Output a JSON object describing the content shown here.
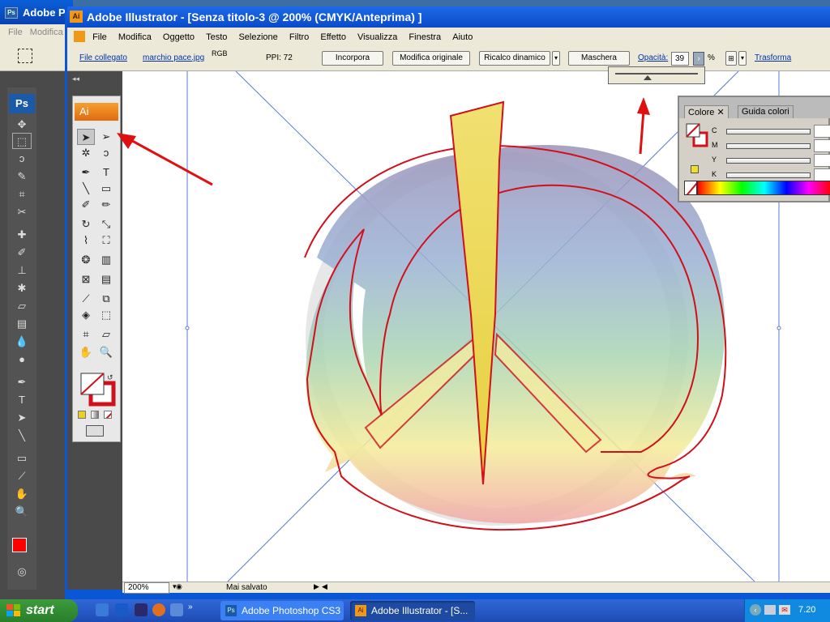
{
  "photoshop": {
    "title": "Adobe P",
    "title_icon": "Ps",
    "menu": "File  Modifica",
    "logo": "Ps"
  },
  "illustrator": {
    "title": "Adobe Illustrator - [Senza titolo-3 @ 200% (CMYK/Anteprima) ]",
    "title_icon": "Ai",
    "menu": [
      "File",
      "Modifica",
      "Oggetto",
      "Testo",
      "Selezione",
      "Filtro",
      "Effetto",
      "Visualizza",
      "Finestra",
      "Aiuto"
    ],
    "control": {
      "linked_file_label": "File collegato",
      "file_name": "marchio pace.jpg",
      "color_mode": "RGB",
      "ppi": "PPI: 72",
      "embed_button": "Incorpora",
      "edit_original_button": "Modifica originale",
      "live_trace_button": "Ricalco dinamico",
      "mask_button": "Maschera",
      "opacity_label": "Opacità:",
      "opacity_value": "39",
      "opacity_unit": "%",
      "transform_link": "Trasforma"
    },
    "opacity_slider_fraction": 0.39,
    "tools_logo": "Ai",
    "status": {
      "zoom": "200%",
      "text": "Mai salvato"
    },
    "color_panel": {
      "tabs": [
        "Colore",
        "Guida colori"
      ],
      "channels": [
        "C",
        "M",
        "Y",
        "K"
      ]
    }
  },
  "taskbar": {
    "start_label": "start",
    "buttons": [
      "Adobe Photoshop CS3",
      "Adobe Illustrator - [S..."
    ],
    "clock": "7.20"
  },
  "colors": {
    "annotation_arrow": "#e01010",
    "peace_stroke": "#d0101a",
    "accent_ai": "#f09818"
  }
}
